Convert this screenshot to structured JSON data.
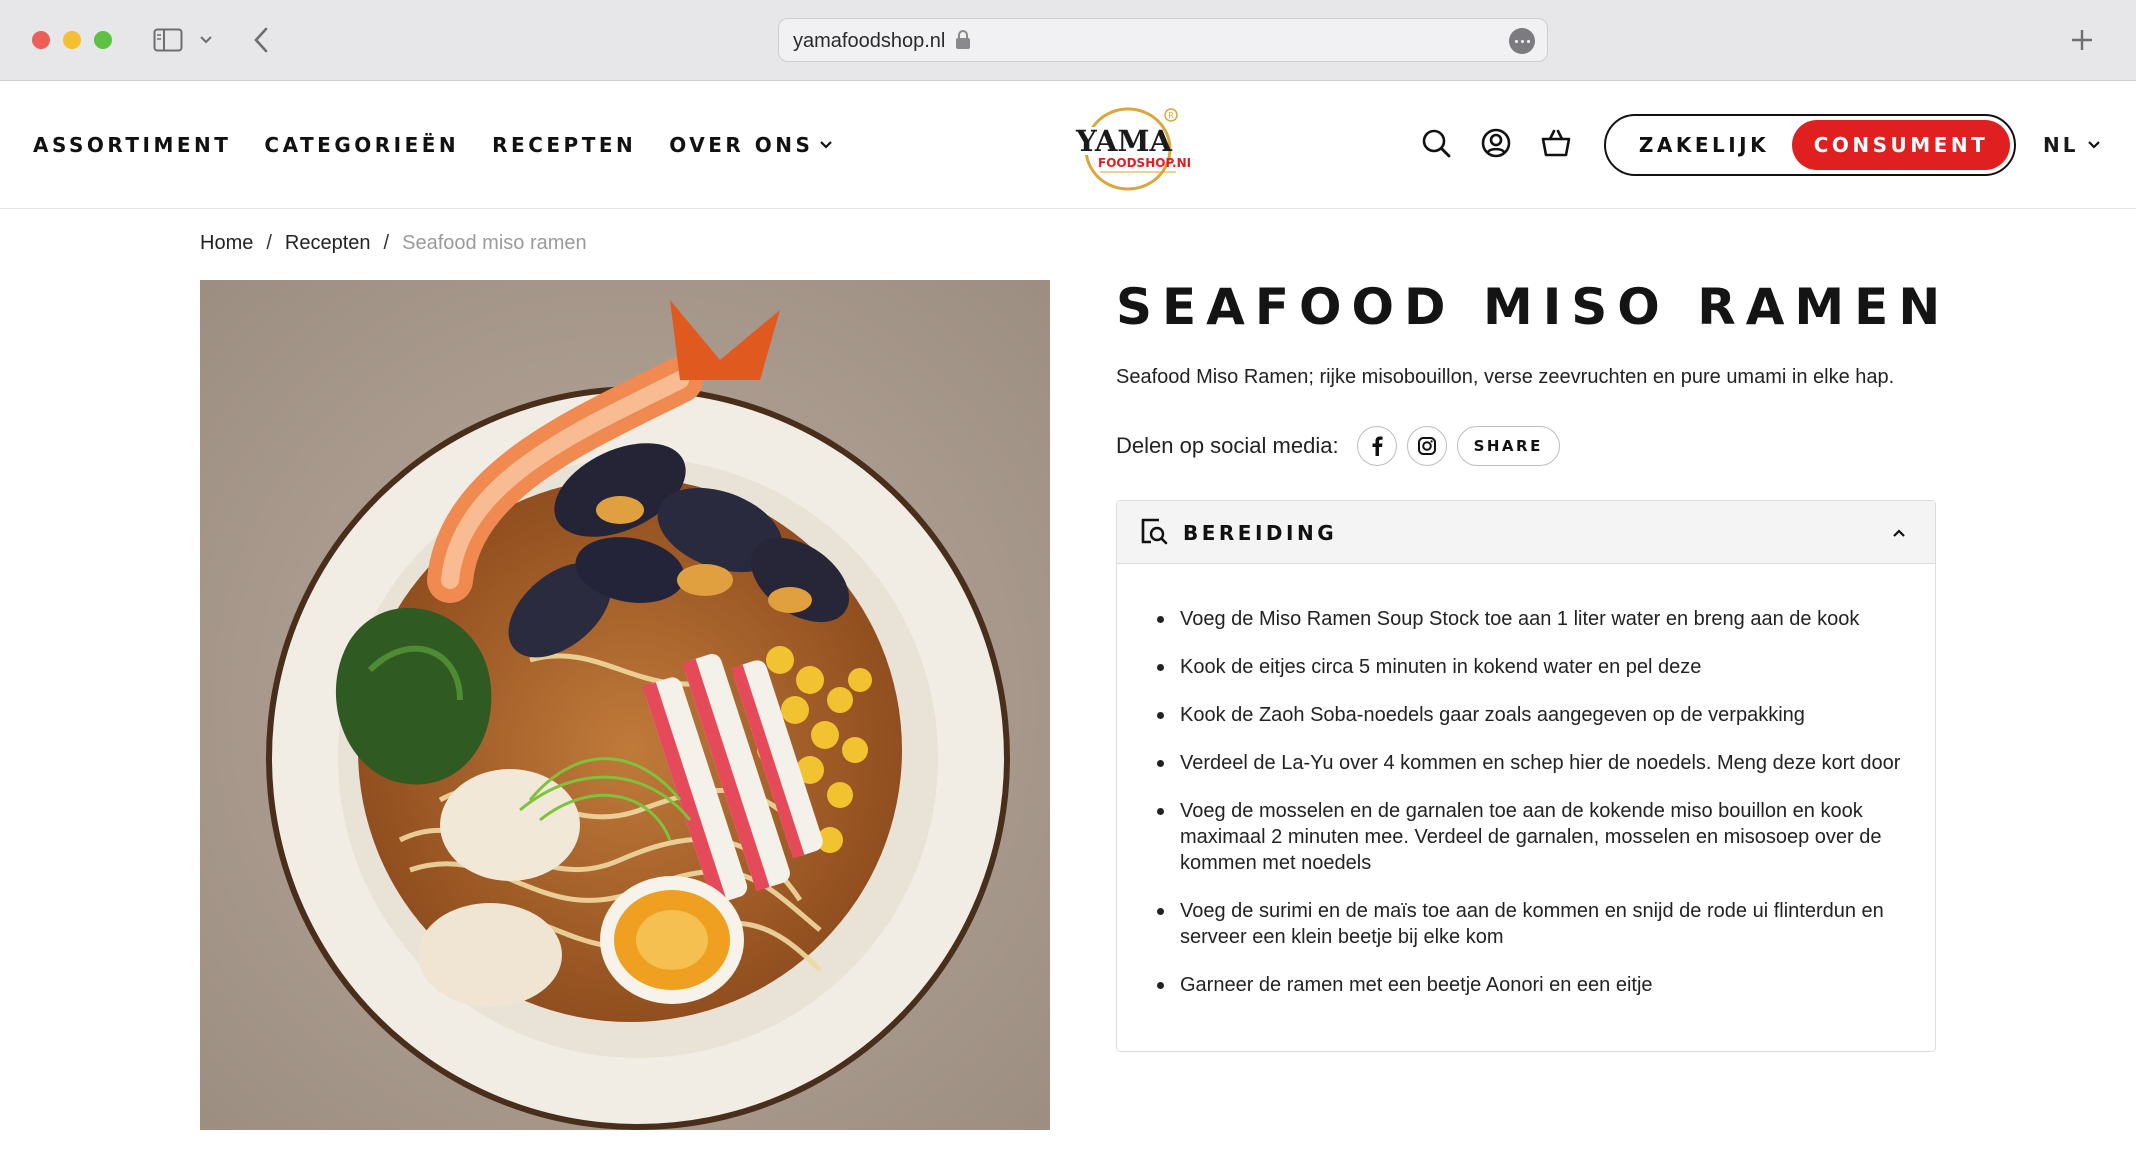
{
  "browser": {
    "url": "yamafoodshop.nl"
  },
  "header": {
    "nav": [
      {
        "label": "ASSORTIMENT"
      },
      {
        "label": "CATEGORIEËN"
      },
      {
        "label": "RECEPTEN"
      },
      {
        "label": "OVER ONS"
      }
    ],
    "logo": {
      "text_main": "YAMA",
      "text_sub": "FOODSHOP.NL"
    },
    "segment": {
      "zakelijk": "ZAKELIJK",
      "consument": "CONSUMENT"
    },
    "language": "NL",
    "brand_color": "#e02020"
  },
  "breadcrumb": {
    "home": "Home",
    "separator": "/",
    "section": "Recepten",
    "current": "Seafood miso ramen"
  },
  "recipe": {
    "title": "SEAFOOD MISO RAMEN",
    "intro": "Seafood Miso Ramen; rijke misobouillon, verse zeevruchten en pure umami in elke hap.",
    "share_label": "Delen op social media:",
    "share_button": "SHARE",
    "preparation": {
      "heading": "BEREIDING",
      "steps": [
        "Voeg de Miso Ramen Soup Stock toe aan 1 liter water en breng aan de kook",
        "Kook de eitjes circa 5 minuten in kokend water en pel deze",
        "Kook de Zaoh Soba-noedels gaar zoals aangegeven op de verpakking",
        "Verdeel de La-Yu over 4 kommen en schep hier de noedels. Meng deze kort door",
        "Voeg de mosselen en de garnalen toe aan de kokende miso bouillon en kook maximaal 2 minuten mee. Verdeel de garnalen, mosselen en misosoep over de kommen met noedels",
        "Voeg de surimi en de maïs toe aan de kommen en snijd de rode ui flinterdun en serveer een klein beetje bij elke kom",
        "Garneer de ramen met een beetje Aonori en een eitje"
      ]
    }
  }
}
